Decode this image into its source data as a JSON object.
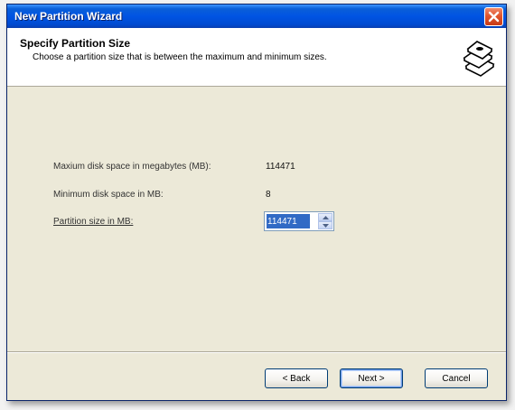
{
  "window": {
    "title": "New Partition Wizard"
  },
  "header": {
    "title": "Specify Partition Size",
    "subtitle": "Choose a partition size that is between the maximum and minimum sizes.",
    "icon": "disk-stack-icon"
  },
  "fields": {
    "max_label": "Maxium disk space in megabytes (MB):",
    "max_value": "114471",
    "min_label": "Minimum disk space in MB:",
    "min_value": "8",
    "size_label": "Partition size in MB:",
    "size_value": "114471"
  },
  "buttons": {
    "back": "< Back",
    "next": "Next >",
    "cancel": "Cancel"
  },
  "colors": {
    "titlebar": "#0054e3",
    "dialog_bg": "#ece9d8",
    "selection": "#316ac5",
    "close": "#e0552e"
  }
}
